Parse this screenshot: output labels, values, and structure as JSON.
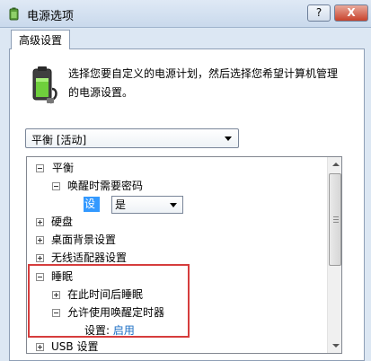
{
  "window": {
    "title": "电源选项",
    "help_label": "?",
    "close_label": "X"
  },
  "tabs": [
    {
      "label": "高级设置"
    }
  ],
  "description": {
    "line1": "选择您要自定义的电源计划，然后选择您希望计算机管理",
    "line2": "的电源设置。"
  },
  "plan_select": {
    "value": "平衡 [活动]"
  },
  "tree": {
    "items": [
      {
        "label": "平衡"
      },
      {
        "label": "唤醒时需要密码"
      },
      {
        "label": "硬盘"
      },
      {
        "label": "桌面背景设置"
      },
      {
        "label": "无线适配器设置"
      },
      {
        "label": "睡眠"
      },
      {
        "label": "在此时间后睡眠"
      },
      {
        "label": "允许使用唤醒定时器"
      },
      {
        "label": "USB 设置"
      }
    ],
    "password_setting": {
      "label": "设置:",
      "value": "是"
    },
    "wake_timer_setting": {
      "label": "设置:",
      "value": "启用"
    }
  },
  "colors": {
    "highlight_box": "#d63d3d",
    "selection": "#3399ff",
    "link": "#1a6dc4"
  },
  "icons": [
    "power-options-icon",
    "battery-power-icon",
    "help-icon",
    "close-icon"
  ]
}
